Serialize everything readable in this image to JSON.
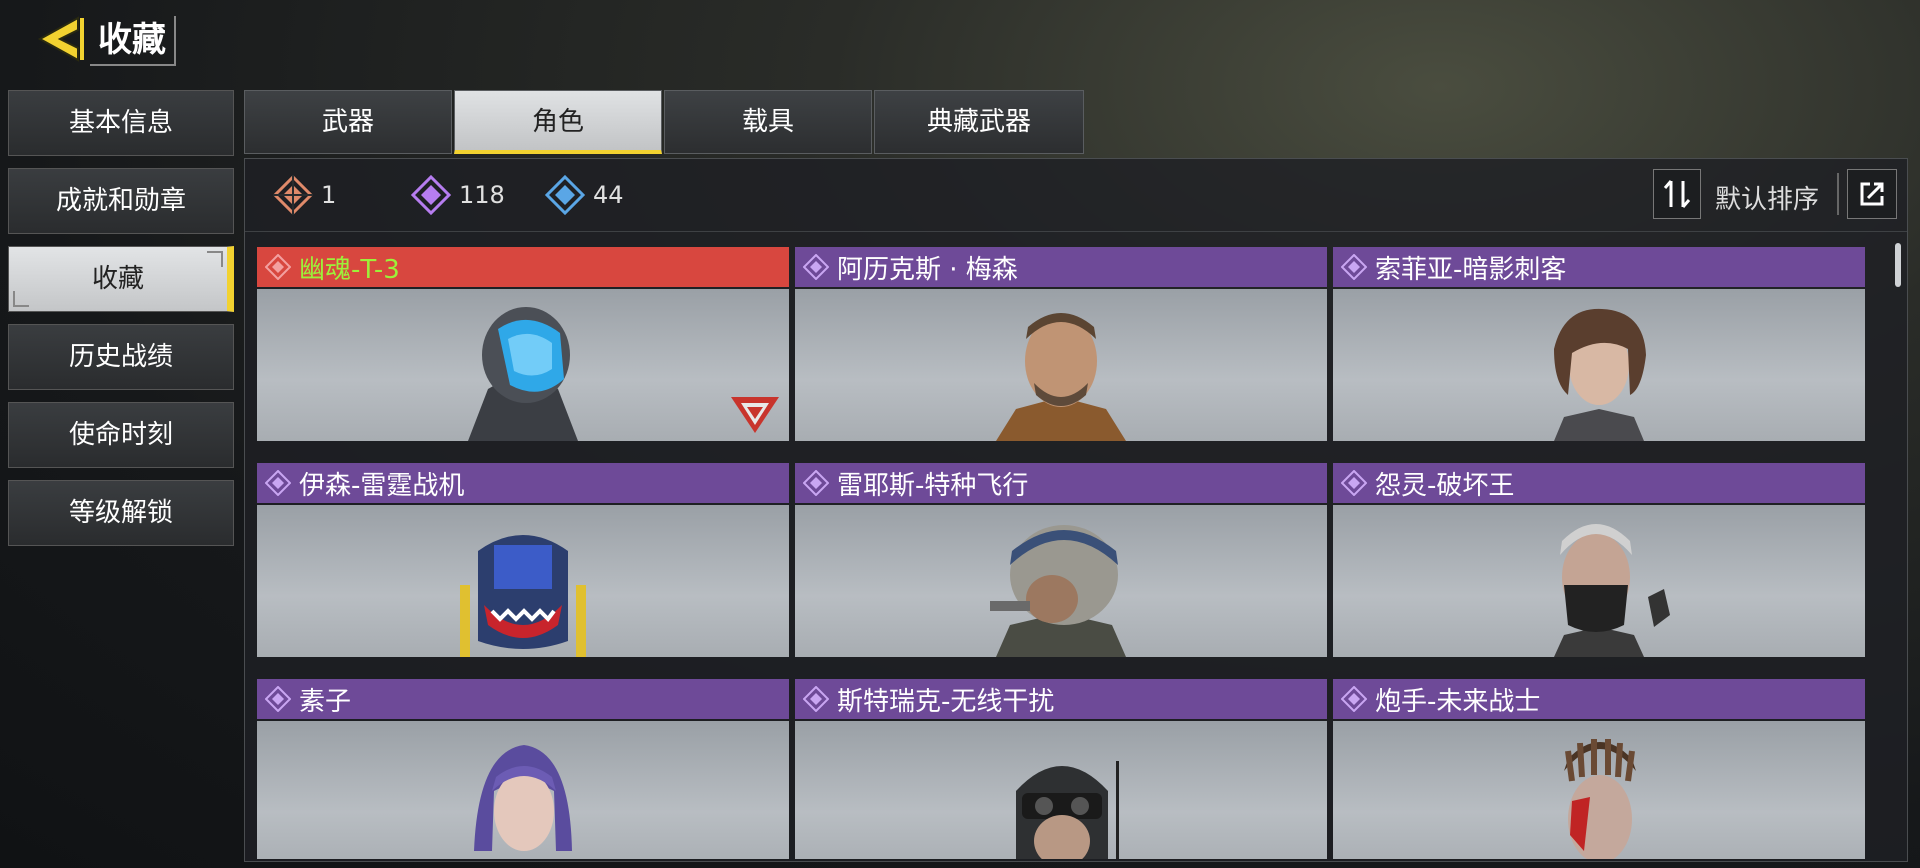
{
  "header": {
    "title": "收藏"
  },
  "sidebar": {
    "items": [
      {
        "label": "基本信息"
      },
      {
        "label": "成就和勋章"
      },
      {
        "label": "收藏"
      },
      {
        "label": "历史战绩"
      },
      {
        "label": "使命时刻"
      },
      {
        "label": "等级解锁"
      }
    ],
    "active_index": 2
  },
  "tabs": [
    {
      "label": "武器"
    },
    {
      "label": "角色"
    },
    {
      "label": "载具"
    },
    {
      "label": "典藏武器"
    }
  ],
  "active_tab": "角色",
  "stats": [
    {
      "icon": "legendary-rarity-icon",
      "value": "1",
      "color": "#e08a6a"
    },
    {
      "icon": "epic-rarity-icon",
      "value": "118",
      "color": "#b67df0"
    },
    {
      "icon": "rare-rarity-icon",
      "value": "44",
      "color": "#5aa6e6"
    }
  ],
  "sort": {
    "label": "默认排序",
    "icon": "sort-icon",
    "export_icon": "export-icon"
  },
  "characters": [
    {
      "name": "幽魂-T-3",
      "rarity": "legendary",
      "badge": true
    },
    {
      "name": "阿历克斯 · 梅森",
      "rarity": "epic"
    },
    {
      "name": "索菲亚-暗影刺客",
      "rarity": "epic"
    },
    {
      "name": "伊森-雷霆战机",
      "rarity": "epic"
    },
    {
      "name": "雷耶斯-特种飞行",
      "rarity": "epic"
    },
    {
      "name": "怨灵-破坏王",
      "rarity": "epic"
    },
    {
      "name": "素子",
      "rarity": "epic"
    },
    {
      "name": "斯特瑞克-无线干扰",
      "rarity": "epic"
    },
    {
      "name": "炮手-未来战士",
      "rarity": "epic"
    }
  ],
  "colors": {
    "accent": "#f2d230",
    "legendary": "#d8473f",
    "epic": "#6e4a98",
    "legendary_name": "#9df03a"
  }
}
